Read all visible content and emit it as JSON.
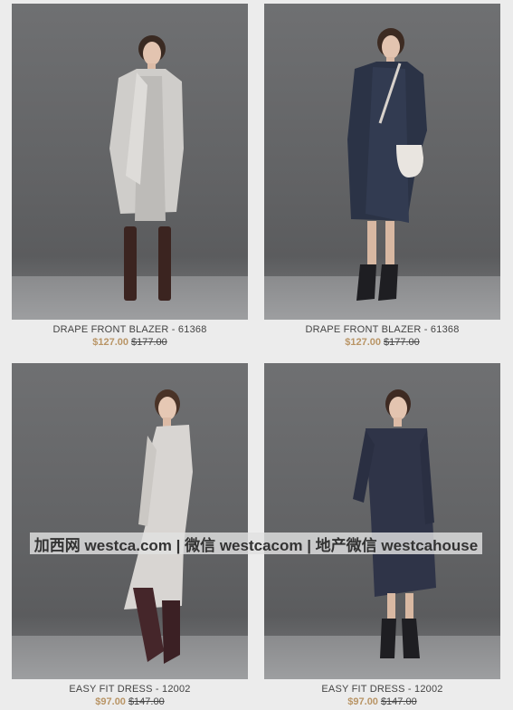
{
  "products": [
    {
      "name": "DRAPE FRONT BLAZER - 61368",
      "sale_price": "$127.00",
      "original_price": "$177.00",
      "image_icon": "model-light-blazer-photo"
    },
    {
      "name": "DRAPE FRONT BLAZER - 61368",
      "sale_price": "$127.00",
      "original_price": "$177.00",
      "image_icon": "model-navy-blazer-photo"
    },
    {
      "name": "EASY FIT DRESS - 12002",
      "sale_price": "$97.00",
      "original_price": "$147.00",
      "image_icon": "model-light-dress-photo"
    },
    {
      "name": "EASY FIT DRESS - 12002",
      "sale_price": "$97.00",
      "original_price": "$147.00",
      "image_icon": "model-navy-dress-photo"
    }
  ],
  "watermark": {
    "text": "加西网 westca.com | 微信 westcacom | 地产微信 westcahouse"
  },
  "colors": {
    "sale_price": "#b99566",
    "background": "#ececec"
  }
}
